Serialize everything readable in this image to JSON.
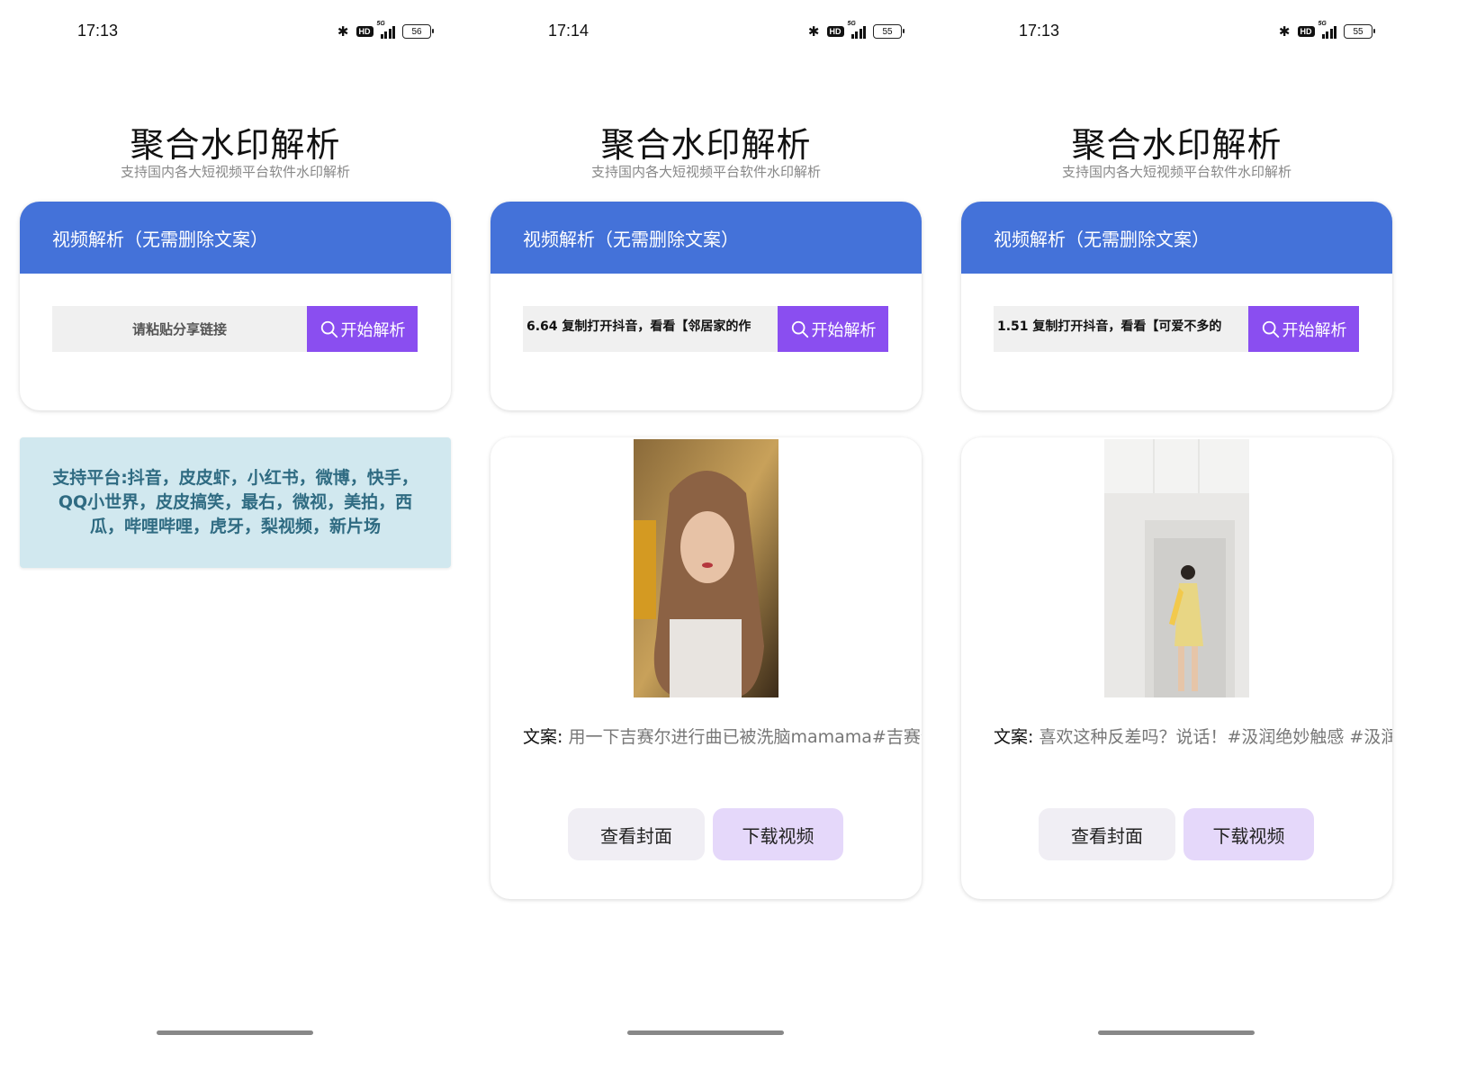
{
  "screens": [
    {
      "time": "17:13",
      "battery": "56",
      "title": "聚合水印解析",
      "subtitle": "支持国内各大短视频平台软件水印解析",
      "card_header": "视频解析（无需删除文案）",
      "input_placeholder": "请粘贴分享链接",
      "input_value": "",
      "search_button": "开始解析",
      "platforms_text": "支持平台:抖音，皮皮虾，小红书，微博，快手，QQ小世界，皮皮搞笑，最右，微视，美拍，西瓜，哔哩哔哩，虎牙，梨视频，新片场"
    },
    {
      "time": "17:14",
      "battery": "55",
      "title": "聚合水印解析",
      "subtitle": "支持国内各大短视频平台软件水印解析",
      "card_header": "视频解析（无需删除文案）",
      "input_value": "6.64 复制打开抖音，看看【邻居家的作",
      "search_button": "开始解析",
      "copy_label": "文案:",
      "copy_text": "用一下吉赛尔进行曲已被洗脑mamama#吉赛尔",
      "cover_button": "查看封面",
      "download_button": "下载视频"
    },
    {
      "time": "17:13",
      "battery": "55",
      "title": "聚合水印解析",
      "subtitle": "支持国内各大短视频平台软件水印解析",
      "card_header": "视频解析（无需删除文案）",
      "input_value": "1.51 复制打开抖音，看看【可爱不多的",
      "search_button": "开始解析",
      "copy_label": "文案:",
      "copy_text": "喜欢这种反差吗？说话！#汲润绝妙触感 #汲润",
      "cover_button": "查看封面",
      "download_button": "下载视频"
    }
  ]
}
